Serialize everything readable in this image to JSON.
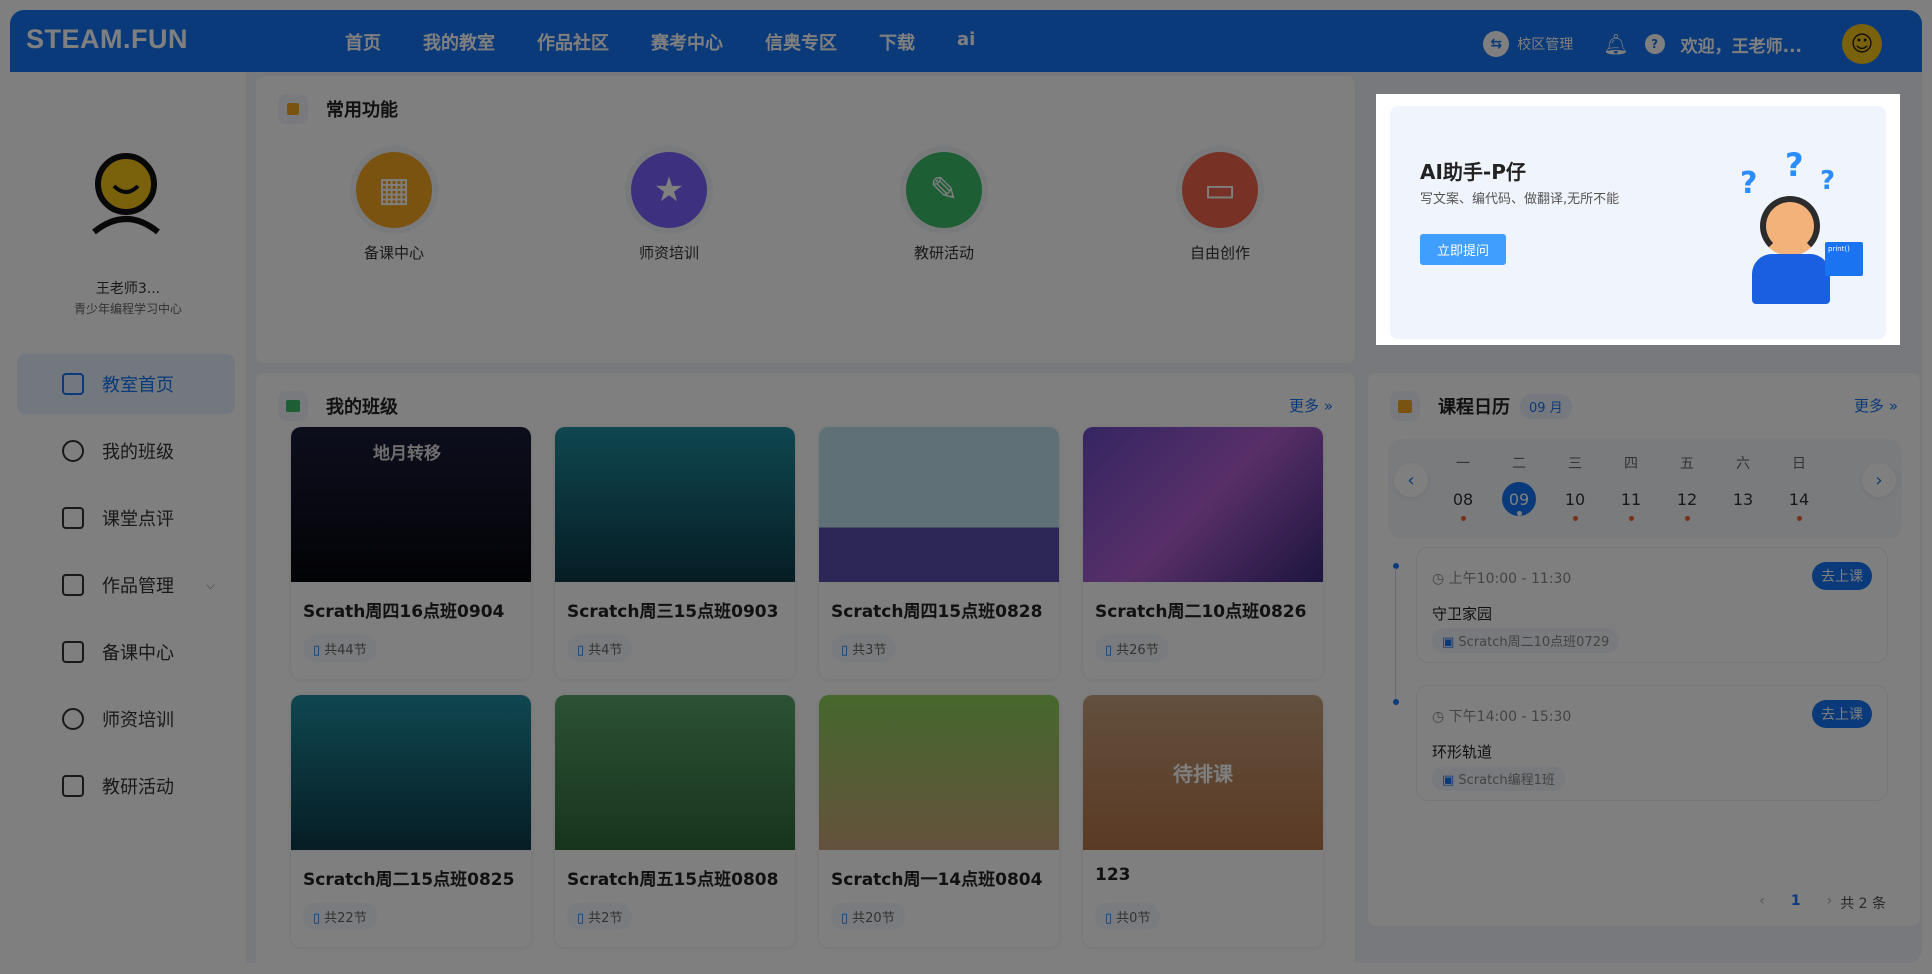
{
  "header": {
    "logo": "STEAM.FUN",
    "nav": [
      "首页",
      "我的教室",
      "作品社区",
      "赛考中心",
      "信奥专区",
      "下载",
      "ai"
    ],
    "campus": "校区管理",
    "welcome": "欢迎，王老师..."
  },
  "user": {
    "name": "王老师3...",
    "org": "青少年编程学习中心"
  },
  "sidebar": {
    "items": [
      {
        "label": "教室首页",
        "active": true
      },
      {
        "label": "我的班级"
      },
      {
        "label": "课堂点评"
      },
      {
        "label": "作品管理",
        "has_submenu": true
      },
      {
        "label": "备课中心"
      },
      {
        "label": "师资培训"
      },
      {
        "label": "教研活动"
      }
    ]
  },
  "functions": {
    "title": "常用功能",
    "items": [
      {
        "label": "备课中心",
        "icon": "calendar-icon",
        "color": "#f5a623"
      },
      {
        "label": "师资培训",
        "icon": "star-icon",
        "color": "#7b61ff"
      },
      {
        "label": "教研活动",
        "icon": "pencil-ruler-icon",
        "color": "#3dbd6a"
      },
      {
        "label": "自由创作",
        "icon": "monitor-icon",
        "color": "#f0624b"
      }
    ]
  },
  "ai": {
    "title": "AI助手-P仔",
    "subtitle": "写文案、编代码、做翻译,无所不能",
    "button": "立即提问",
    "badge_text": "print()"
  },
  "classes": {
    "title": "我的班级",
    "more": "更多 »",
    "items": [
      {
        "name": "Scrath周四16点班0904",
        "lessons": "共44节",
        "thumb_text": "地月转移"
      },
      {
        "name": "Scratch周三15点班0903",
        "lessons": "共4节"
      },
      {
        "name": "Scratch周四15点班0828",
        "lessons": "共3节"
      },
      {
        "name": "Scratch周二10点班0826",
        "lessons": "共26节"
      },
      {
        "name": "Scratch周二15点班0825",
        "lessons": "共22节"
      },
      {
        "name": "Scratch周五15点班0808",
        "lessons": "共2节"
      },
      {
        "name": "Scratch周一14点班0804",
        "lessons": "共20节"
      },
      {
        "name": "123",
        "lessons": "共0节",
        "overlay": "待排课"
      }
    ]
  },
  "calendar": {
    "title": "课程日历",
    "month": "09 月",
    "more": "更多 »",
    "weekdays": [
      "一",
      "二",
      "三",
      "四",
      "五",
      "六",
      "日"
    ],
    "days": [
      "08",
      "09",
      "10",
      "11",
      "12",
      "13",
      "14"
    ],
    "selected": "09",
    "events": [
      {
        "time": "上午10:00 - 11:30",
        "name": "守卫家园",
        "class": "Scratch周二10点班0729",
        "button": "去上课"
      },
      {
        "time": "下午14:00 - 15:30",
        "name": "环形轨道",
        "class": "Scratch编程1班",
        "button": "去上课"
      }
    ],
    "pagination": {
      "page": "1",
      "total": "共 2 条"
    }
  }
}
